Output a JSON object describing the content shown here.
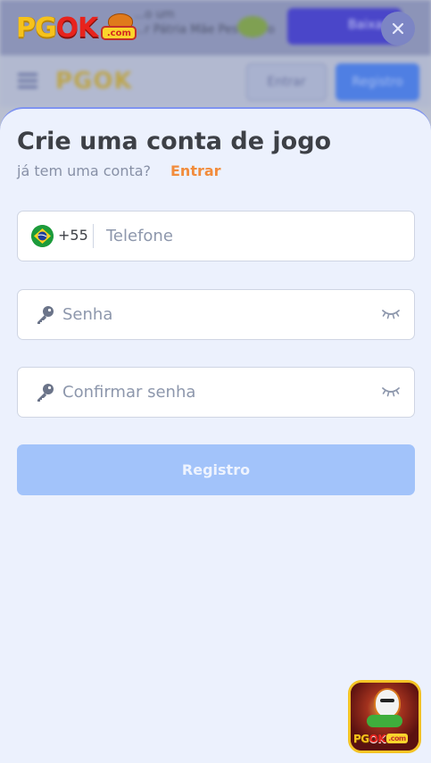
{
  "brand": {
    "logo_pg": "PG",
    "logo_ok": "OK",
    "logo_com": ".com"
  },
  "background": {
    "promo_text_line1": "...o um",
    "promo_text_line2": "...r Pátria Mãe Pesqueiro",
    "download_label": "Baixar",
    "login_label": "Entrar",
    "register_label": "Registro"
  },
  "modal": {
    "title": "Crie uma conta de jogo",
    "subtitle": "já tem uma conta?",
    "login_link": "Entrar",
    "phone": {
      "country_code": "+55",
      "placeholder": "Telefone",
      "value": ""
    },
    "password": {
      "placeholder": "Senha",
      "value": ""
    },
    "confirm_password": {
      "placeholder": "Confirmar senha",
      "value": ""
    },
    "submit_label": "Registro"
  },
  "app_icon": {
    "label_pg": "PG",
    "label_ok": "OK",
    "label_com": ".com"
  },
  "colors": {
    "accent_orange": "#f28c3c",
    "button_disabled_blue": "#a2c3fa",
    "sheet_background": "#ecf1fd",
    "title_text": "#3d4046"
  },
  "icons": {
    "close": "close-icon",
    "flag": "brazil-flag-icon",
    "key": "key-icon",
    "eye": "eye-closed-icon",
    "menu": "hamburger-menu-icon"
  }
}
